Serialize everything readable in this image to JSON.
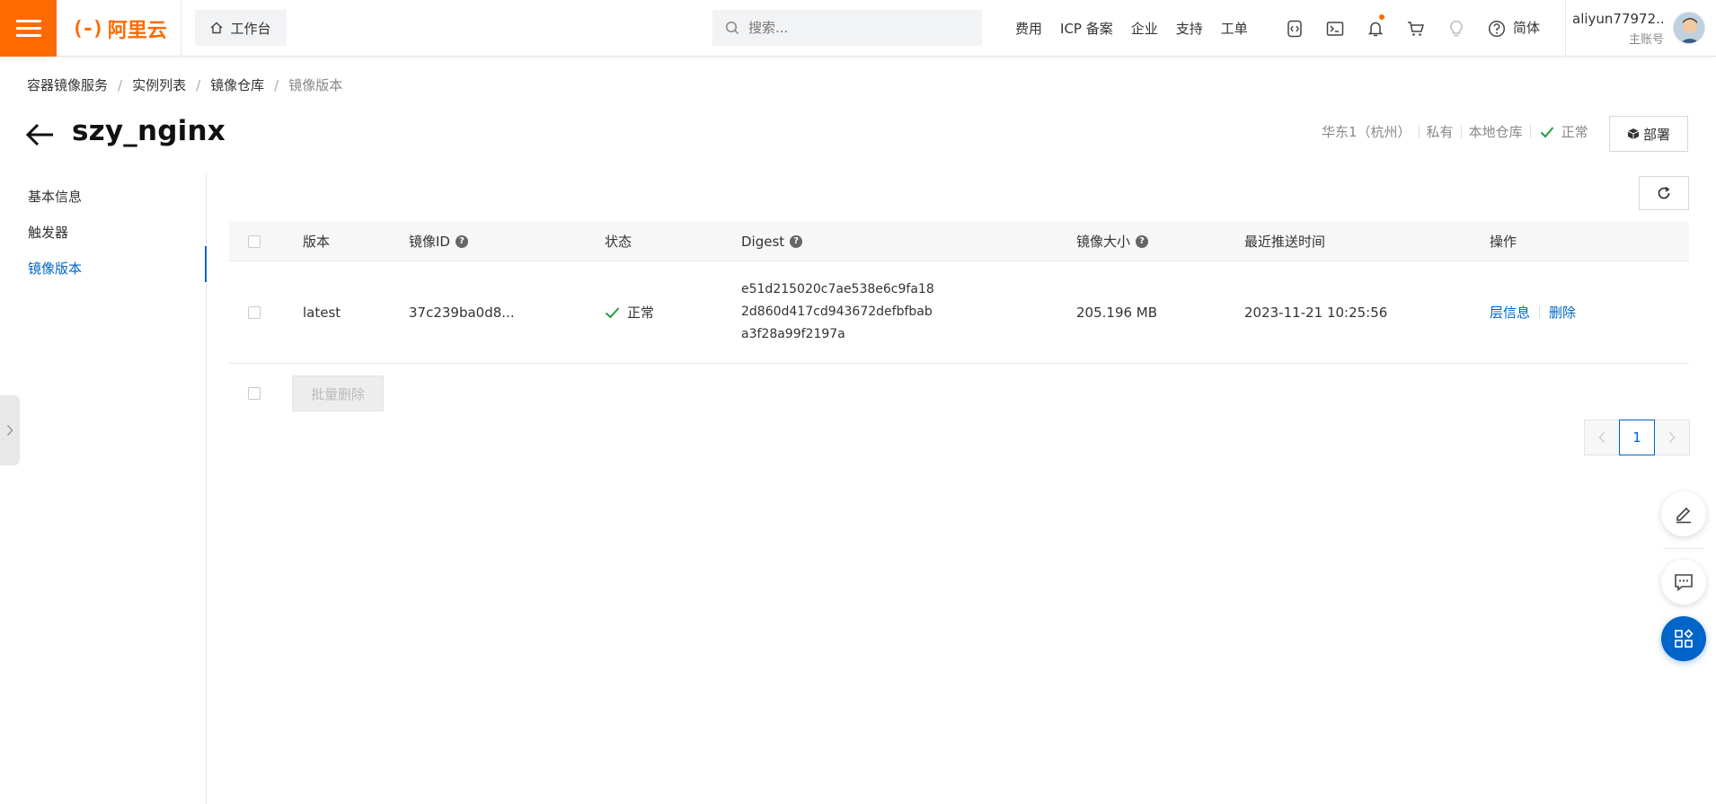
{
  "topbar": {
    "logo_text": "阿里云",
    "logo_mark": "(-)",
    "workbench_label": "工作台",
    "search_placeholder": "搜索...",
    "links": [
      "费用",
      "ICP 备案",
      "企业",
      "支持",
      "工单"
    ],
    "icons": [
      "code-icon",
      "terminal-icon",
      "bell-icon",
      "cart-icon",
      "lightbulb-icon",
      "help-icon"
    ],
    "language": "简体",
    "username": "aliyun77972...",
    "user_role": "主账号",
    "accent_color": "#ff6a00"
  },
  "breadcrumb": [
    "容器镜像服务",
    "实例列表",
    "镜像仓库",
    "镜像版本"
  ],
  "page": {
    "title": "szy_nginx",
    "region": "华东1（杭州）",
    "visibility": "私有",
    "repo_type": "本地仓库",
    "status": "正常",
    "deploy_label": "部署"
  },
  "subnav": {
    "items": [
      "基本信息",
      "触发器",
      "镜像版本"
    ],
    "active_index": 2
  },
  "table": {
    "headers": {
      "version": "版本",
      "image_id": "镜像ID",
      "status": "状态",
      "digest": "Digest",
      "size": "镜像大小",
      "pushed": "最近推送时间",
      "ops": "操作"
    },
    "rows": [
      {
        "version": "latest",
        "image_id": "37c239ba0d8...",
        "status": "正常",
        "digest_lines": [
          "e51d215020c7ae538e6c9fa18",
          "2d860d417cd943672defbfbab",
          "a3f28a99f2197a"
        ],
        "size": "205.196 MB",
        "pushed": "2023-11-21 10:25:56",
        "op_layer": "层信息",
        "op_delete": "删除"
      }
    ],
    "batch_delete_label": "批量删除"
  },
  "pagination": {
    "current": "1"
  },
  "colors": {
    "link": "#0064c8",
    "success": "#1e9e3e"
  }
}
